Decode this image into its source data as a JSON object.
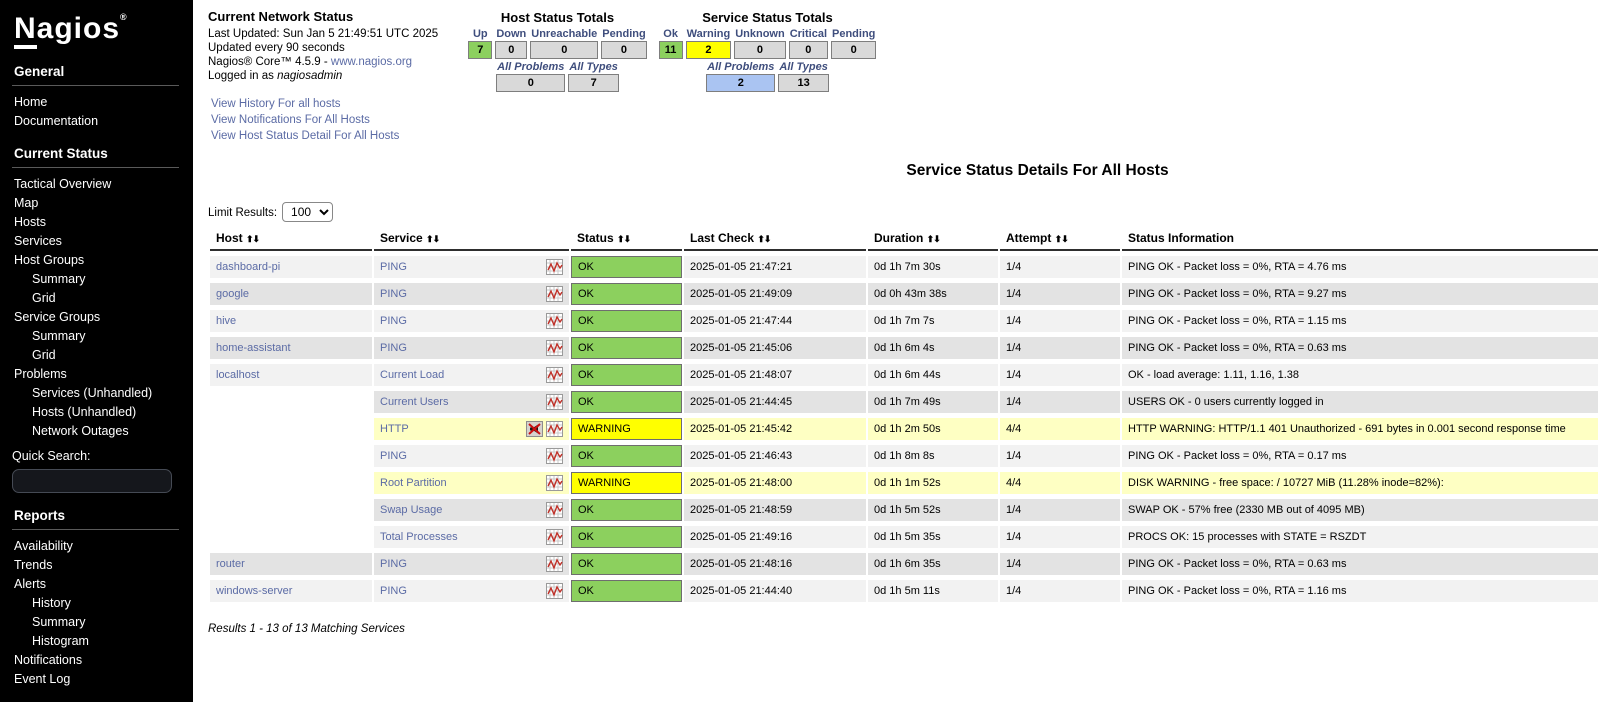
{
  "sidebar": {
    "logo": "Nagios",
    "logo_reg": "®",
    "items": [
      {
        "type": "section",
        "label": "General"
      },
      {
        "type": "link",
        "label": "Home"
      },
      {
        "type": "link",
        "label": "Documentation"
      },
      {
        "type": "section",
        "label": "Current Status"
      },
      {
        "type": "link",
        "label": "Tactical Overview"
      },
      {
        "type": "link",
        "label": "Map"
      },
      {
        "type": "link",
        "label": "Hosts"
      },
      {
        "type": "link",
        "label": "Services"
      },
      {
        "type": "link",
        "label": "Host Groups"
      },
      {
        "type": "sublink",
        "label": "Summary"
      },
      {
        "type": "sublink",
        "label": "Grid"
      },
      {
        "type": "link",
        "label": "Service Groups"
      },
      {
        "type": "sublink",
        "label": "Summary"
      },
      {
        "type": "sublink",
        "label": "Grid"
      },
      {
        "type": "link",
        "label": "Problems"
      },
      {
        "type": "sublink",
        "label": "Services (Unhandled)"
      },
      {
        "type": "sublink",
        "label": "Hosts (Unhandled)"
      },
      {
        "type": "sublink",
        "label": "Network Outages"
      },
      {
        "type": "label",
        "label": "Quick Search:"
      },
      {
        "type": "search",
        "label": ""
      },
      {
        "type": "section",
        "label": "Reports"
      },
      {
        "type": "link",
        "label": "Availability"
      },
      {
        "type": "link",
        "label": "Trends"
      },
      {
        "type": "link",
        "label": "Alerts"
      },
      {
        "type": "sublink",
        "label": "History"
      },
      {
        "type": "sublink",
        "label": "Summary"
      },
      {
        "type": "sublink",
        "label": "Histogram"
      },
      {
        "type": "link",
        "label": "Notifications"
      },
      {
        "type": "link",
        "label": "Event Log"
      }
    ]
  },
  "status_header": {
    "title": "Current Network Status",
    "lines": [
      "Last Updated: Sun Jan 5 21:49:51 UTC 2025",
      "Updated every 90 seconds"
    ],
    "core_prefix": "Nagios® Core™ 4.5.9 - ",
    "core_link": "www.nagios.org",
    "logged_in_prefix": "Logged in as ",
    "logged_in_user": "nagiosadmin",
    "links": [
      "View History For all hosts",
      "View Notifications For All Hosts",
      "View Host Status Detail For All Hosts"
    ]
  },
  "host_totals": {
    "title": "Host Status Totals",
    "columns": [
      {
        "label": "Up",
        "value": "7",
        "style": "ok"
      },
      {
        "label": "Down",
        "value": "0",
        "style": "neutral"
      },
      {
        "label": "Unreachable",
        "value": "0",
        "style": "neutral"
      },
      {
        "label": "Pending",
        "value": "0",
        "style": "neutral"
      }
    ],
    "summary": [
      {
        "label": "All Problems",
        "value": "0",
        "style": "neutral"
      },
      {
        "label": "All Types",
        "value": "7",
        "style": "neutral"
      }
    ]
  },
  "service_totals": {
    "title": "Service Status Totals",
    "columns": [
      {
        "label": "Ok",
        "value": "11",
        "style": "ok"
      },
      {
        "label": "Warning",
        "value": "2",
        "style": "warning"
      },
      {
        "label": "Unknown",
        "value": "0",
        "style": "neutral"
      },
      {
        "label": "Critical",
        "value": "0",
        "style": "neutral"
      },
      {
        "label": "Pending",
        "value": "0",
        "style": "neutral"
      }
    ],
    "summary": [
      {
        "label": "All Problems",
        "value": "2",
        "style": "problems"
      },
      {
        "label": "All Types",
        "value": "13",
        "style": "neutral"
      }
    ]
  },
  "main": {
    "page_title": "Service Status Details For All Hosts",
    "limit_label": "Limit Results:",
    "limit_value": "100",
    "columns": [
      {
        "label": "Host",
        "sortable": true
      },
      {
        "label": "Service",
        "sortable": true
      },
      {
        "label": "Status",
        "sortable": true
      },
      {
        "label": "Last Check",
        "sortable": true
      },
      {
        "label": "Duration",
        "sortable": true
      },
      {
        "label": "Attempt",
        "sortable": true
      },
      {
        "label": "Status Information",
        "sortable": false
      }
    ],
    "rows": [
      {
        "host": "dashboard-pi",
        "service": "PING",
        "status": "OK",
        "status_class": "ok",
        "last_check": "2025-01-05 21:47:21",
        "duration": "0d 1h 7m 30s",
        "attempt": "1/4",
        "info": "PING OK - Packet loss = 0%, RTA = 4.76 ms",
        "row_class": "light",
        "notif_disabled": false
      },
      {
        "host": "google",
        "service": "PING",
        "status": "OK",
        "status_class": "ok",
        "last_check": "2025-01-05 21:49:09",
        "duration": "0d 0h 43m 38s",
        "attempt": "1/4",
        "info": "PING OK - Packet loss = 0%, RTA = 9.27 ms",
        "row_class": "dark",
        "notif_disabled": false
      },
      {
        "host": "hive",
        "service": "PING",
        "status": "OK",
        "status_class": "ok",
        "last_check": "2025-01-05 21:47:44",
        "duration": "0d 1h 7m 7s",
        "attempt": "1/4",
        "info": "PING OK - Packet loss = 0%, RTA = 1.15 ms",
        "row_class": "light",
        "notif_disabled": false
      },
      {
        "host": "home-assistant",
        "service": "PING",
        "status": "OK",
        "status_class": "ok",
        "last_check": "2025-01-05 21:45:06",
        "duration": "0d 1h 6m 4s",
        "attempt": "1/4",
        "info": "PING OK - Packet loss = 0%, RTA = 0.63 ms",
        "row_class": "dark",
        "notif_disabled": false
      },
      {
        "host": "localhost",
        "service": "Current Load",
        "status": "OK",
        "status_class": "ok",
        "last_check": "2025-01-05 21:48:07",
        "duration": "0d 1h 6m 44s",
        "attempt": "1/4",
        "info": "OK - load average: 1.11, 1.16, 1.38",
        "row_class": "light",
        "notif_disabled": false
      },
      {
        "host": "",
        "service": "Current Users",
        "status": "OK",
        "status_class": "ok",
        "last_check": "2025-01-05 21:44:45",
        "duration": "0d 1h 7m 49s",
        "attempt": "1/4",
        "info": "USERS OK - 0 users currently logged in",
        "row_class": "dark",
        "notif_disabled": false
      },
      {
        "host": "",
        "service": "HTTP",
        "status": "WARNING",
        "status_class": "warning",
        "last_check": "2025-01-05 21:45:42",
        "duration": "0d 1h 2m 50s",
        "attempt": "4/4",
        "info": "HTTP WARNING: HTTP/1.1 401 Unauthorized - 691 bytes in 0.001 second response time",
        "row_class": "warnrow",
        "notif_disabled": true
      },
      {
        "host": "",
        "service": "PING",
        "status": "OK",
        "status_class": "ok",
        "last_check": "2025-01-05 21:46:43",
        "duration": "0d 1h 8m 8s",
        "attempt": "1/4",
        "info": "PING OK - Packet loss = 0%, RTA = 0.17 ms",
        "row_class": "light",
        "notif_disabled": false
      },
      {
        "host": "",
        "service": "Root Partition",
        "status": "WARNING",
        "status_class": "warning",
        "last_check": "2025-01-05 21:48:00",
        "duration": "0d 1h 1m 52s",
        "attempt": "4/4",
        "info": "DISK WARNING - free space: / 10727 MiB (11.28% inode=82%):",
        "row_class": "warnrow",
        "notif_disabled": false
      },
      {
        "host": "",
        "service": "Swap Usage",
        "status": "OK",
        "status_class": "ok",
        "last_check": "2025-01-05 21:48:59",
        "duration": "0d 1h 5m 52s",
        "attempt": "1/4",
        "info": "SWAP OK - 57% free (2330 MB out of 4095 MB)",
        "row_class": "dark",
        "notif_disabled": false
      },
      {
        "host": "",
        "service": "Total Processes",
        "status": "OK",
        "status_class": "ok",
        "last_check": "2025-01-05 21:49:16",
        "duration": "0d 1h 5m 35s",
        "attempt": "1/4",
        "info": "PROCS OK: 15 processes with STATE = RSZDT",
        "row_class": "light",
        "notif_disabled": false
      },
      {
        "host": "router",
        "service": "PING",
        "status": "OK",
        "status_class": "ok",
        "last_check": "2025-01-05 21:48:16",
        "duration": "0d 1h 6m 35s",
        "attempt": "1/4",
        "info": "PING OK - Packet loss = 0%, RTA = 0.63 ms",
        "row_class": "dark",
        "notif_disabled": false
      },
      {
        "host": "windows-server",
        "service": "PING",
        "status": "OK",
        "status_class": "ok",
        "last_check": "2025-01-05 21:44:40",
        "duration": "0d 1h 5m 11s",
        "attempt": "1/4",
        "info": "PING OK - Packet loss = 0%, RTA = 1.16 ms",
        "row_class": "light",
        "notif_disabled": false
      }
    ],
    "results_note": "Results 1 - 13 of 13 Matching Services"
  },
  "icons": {
    "sort_asc": "⬆",
    "sort_desc": "⬇",
    "graph": "trend-graph-icon",
    "notifications_disabled": "notifications-disabled-icon"
  },
  "colors": {
    "ok_green": "#8cd05e",
    "warning_yellow": "#ffff00",
    "warning_row_bg": "#feffc3",
    "row_light": "#f2f2f2",
    "row_dark": "#e3e3e3",
    "all_problems_blue": "#aac4f2",
    "neutral_gray": "#d9d9d9",
    "link_blue": "#5b6ba5",
    "totals_header_blue": "#3f4e7d",
    "sidebar_bg": "#000000"
  }
}
